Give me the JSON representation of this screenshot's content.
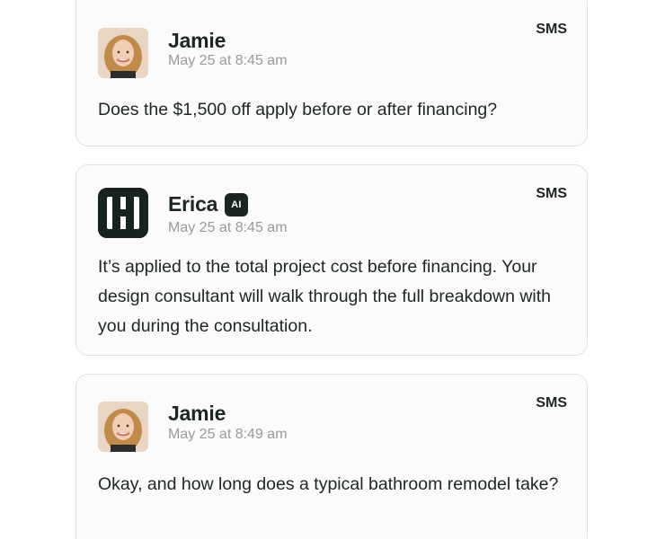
{
  "messages": [
    {
      "sender": "Jamie",
      "avatar": "contact-photo",
      "timestamp": "May 25 at 8:45 am",
      "channel": "SMS",
      "text": "Does the $1,500 off apply before or after financing?"
    },
    {
      "sender": "Erica",
      "avatar": "brand-logo-icon",
      "badge": "AI",
      "timestamp": "May 25 at 8:45 am",
      "channel": "SMS",
      "text": "It’s applied to the total project cost before financing. Your design consultant will walk through the full breakdown with you during the consultation."
    },
    {
      "sender": "Jamie",
      "avatar": "contact-photo",
      "timestamp": "May 25 at 8:49 am",
      "channel": "SMS",
      "text": "Okay, and how long does a typical bathroom remodel take?"
    }
  ],
  "colors": {
    "card_background": "#fbfbfb",
    "card_border": "#e2e2e2",
    "text_primary": "#1e2621",
    "text_muted": "#9a9a9a",
    "brand_dark": "#172320"
  }
}
